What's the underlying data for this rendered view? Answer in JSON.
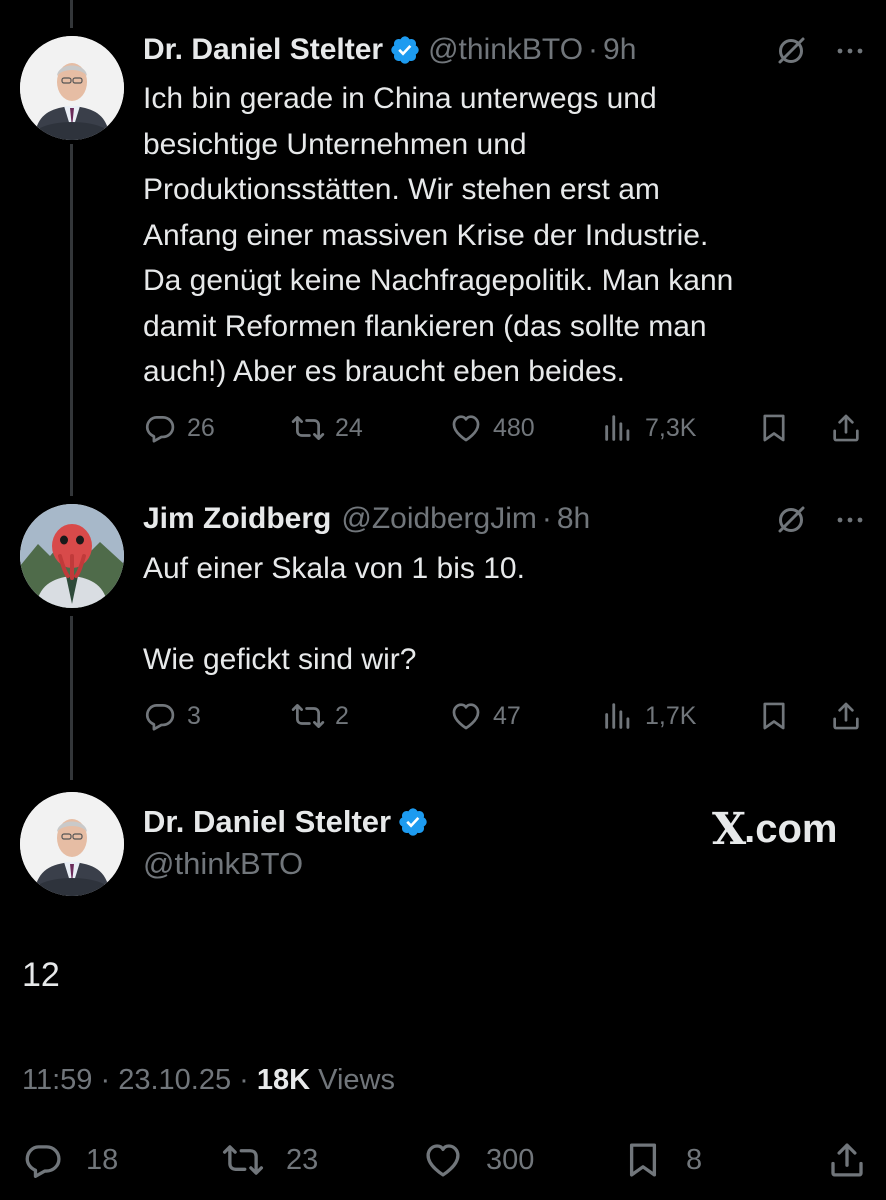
{
  "posts": [
    {
      "name": "Dr. Daniel Stelter",
      "handle": "@thinkBTO",
      "time": "9h",
      "separator": "·",
      "text": "Ich bin gerade in China unterwegs und\nbesichtige Unternehmen und\nProduktionsstätten. Wir stehen erst am\nAnfang einer massiven Krise der Industrie.\nDa genügt keine Nachfragepolitik. Man kann\ndamit Reformen flankieren (das sollte man\nauch!) Aber es braucht eben beides.",
      "replies": "26",
      "reposts": "24",
      "likes": "480",
      "views": "7,3K"
    },
    {
      "name": "Jim Zoidberg",
      "handle": "@ZoidbergJim",
      "time": "8h",
      "separator": "·",
      "text": "Auf einer Skala von 1 bis 10.\n\nWie gefickt sind wir?",
      "replies": "3",
      "reposts": "2",
      "likes": "47",
      "views": "1,7K"
    }
  ],
  "main_post": {
    "name": "Dr. Daniel Stelter",
    "handle": "@thinkBTO",
    "brand": ".com",
    "brand_mark": "X",
    "text": "12",
    "time": "11:59",
    "date": "23.10.25",
    "separator": "·",
    "views_count": "18K",
    "views_label": "Views",
    "replies": "18",
    "reposts": "23",
    "likes": "300",
    "bookmarks": "8"
  },
  "colors": {
    "background": "#000000",
    "text": "#e7e9ea",
    "muted": "#71767b",
    "verified": "#1d9bf0",
    "thread_line": "#333639"
  },
  "icons": [
    "verified-badge-icon",
    "grok-icon",
    "more-icon",
    "reply-icon",
    "repost-icon",
    "like-icon",
    "views-icon",
    "bookmark-icon",
    "share-icon"
  ]
}
